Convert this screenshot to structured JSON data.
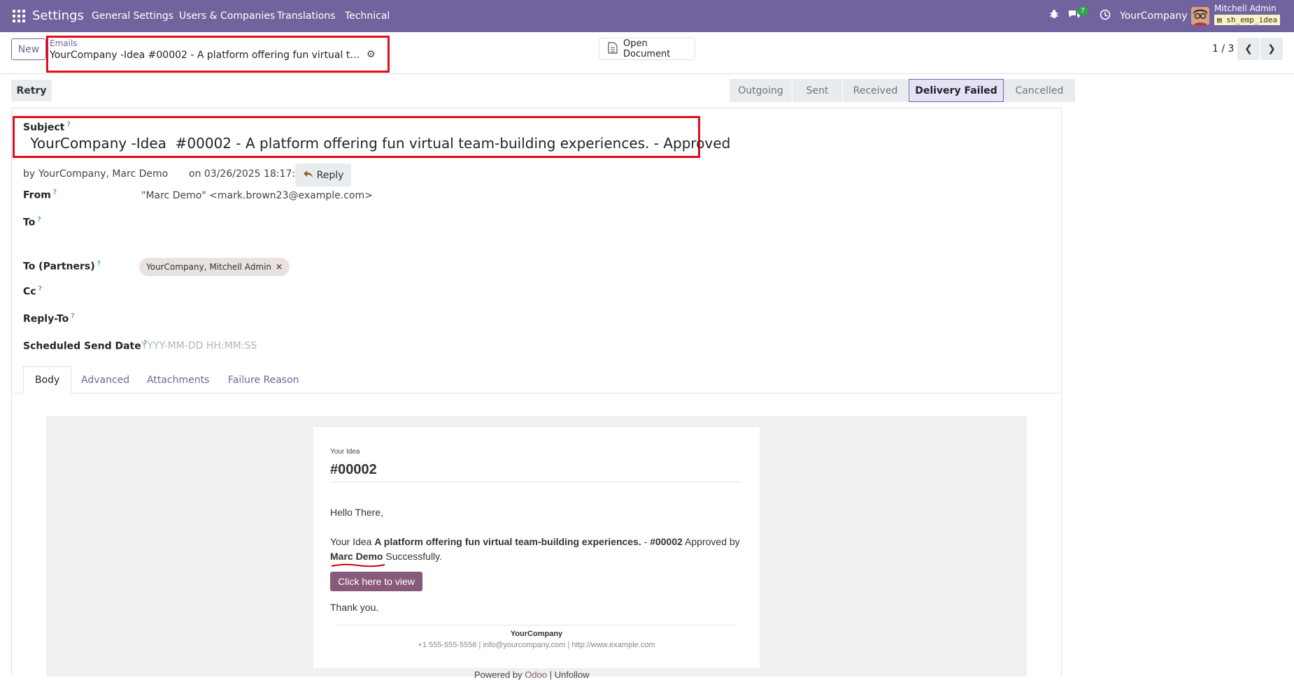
{
  "topbar": {
    "app_name": "Settings",
    "menu": [
      "General Settings",
      "Users & Companies",
      "Translations",
      "Technical"
    ],
    "badge_count": "7",
    "company": "YourCompany",
    "user_name": "Mitchell Admin",
    "db_name": "sh_emp_idea",
    "bar_color": "#71639e"
  },
  "control": {
    "new_label": "New",
    "breadcrumb": "Emails",
    "record_title": "YourCompany -Idea #00002 - A platform offering fun virtual team-building experiences. - Approved",
    "open_document": "Open Document",
    "pager": "1 / 3",
    "retry_label": "Retry",
    "stages": [
      "Outgoing",
      "Sent",
      "Received",
      "Delivery Failed",
      "Cancelled"
    ],
    "active_stage": "Delivery Failed"
  },
  "form": {
    "subject_label": "Subject",
    "subject_value": " YourCompany -Idea  #00002 - A platform offering fun virtual team-building experiences. - Approved",
    "by_prefix": "by",
    "by_value": "YourCompany, Marc Demo",
    "on_value": "on 03/26/2025 18:17:44",
    "reply_label": "Reply",
    "help_mark": "?",
    "from_label": "From",
    "from_value": "\"Marc Demo\" <mark.brown23@example.com>",
    "to_label": "To",
    "to_partners_label": "To (Partners)",
    "partner_chip": "YourCompany, Mitchell Admin",
    "cc_label": "Cc",
    "replyto_label": "Reply-To",
    "scheduled_label": "Scheduled Send Date",
    "scheduled_placeholder": "YYYY-MM-DD HH:MM:SS"
  },
  "tabs": [
    "Body",
    "Advanced",
    "Attachments",
    "Failure Reason"
  ],
  "mail": {
    "small_title": "Your Idea",
    "number": "#00002",
    "greeting": "Hello There,",
    "line_prefix": "Your Idea",
    "idea_name": "A platform offering fun virtual team-building experiences.",
    "dash": "-",
    "idea_number": "#00002",
    "approved_by": "Approved by",
    "approver": "Marc Demo",
    "success": "Successfully.",
    "button": "Click here to view",
    "thanks": "Thank you.",
    "footer_company": "YourCompany",
    "footer_contact": "+1 555-555-5556 | info@yourcompany.com | http://www.example.com",
    "powered_by": "Powered by",
    "powered_link": "Odoo",
    "unfollow": "| Unfollow"
  }
}
